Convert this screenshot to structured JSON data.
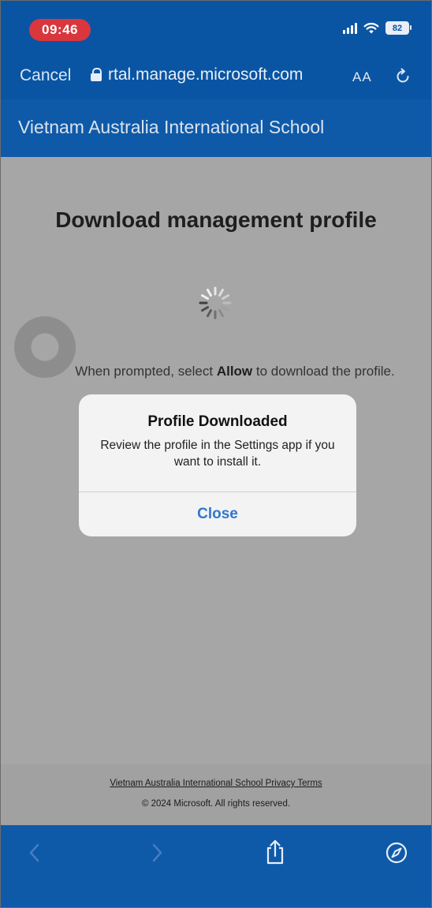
{
  "status_bar": {
    "time": "09:46",
    "battery": "82"
  },
  "safari": {
    "cancel_label": "Cancel",
    "url": "rtal.manage.microsoft.com",
    "text_size_label": "AA"
  },
  "site": {
    "title": "Vietnam Australia International School"
  },
  "main": {
    "heading": "Download management profile",
    "prompt_before": "When prompted, select ",
    "prompt_bold": "Allow",
    "prompt_after": " to download the profile."
  },
  "alert": {
    "title": "Profile Downloaded",
    "message": "Review the profile in the Settings app if you want to install it.",
    "close_label": "Close"
  },
  "footer": {
    "links": "Vietnam Australia International School Privacy Terms",
    "copyright": "© 2024 Microsoft. All rights reserved."
  },
  "icons": {
    "back": "chevron-left-icon",
    "forward": "chevron-right-icon",
    "share": "share-icon",
    "compass": "compass-icon"
  },
  "colors": {
    "brand_blue": "#0f5aa8",
    "status_red": "#d9363e",
    "link_blue": "#2f77d1"
  }
}
